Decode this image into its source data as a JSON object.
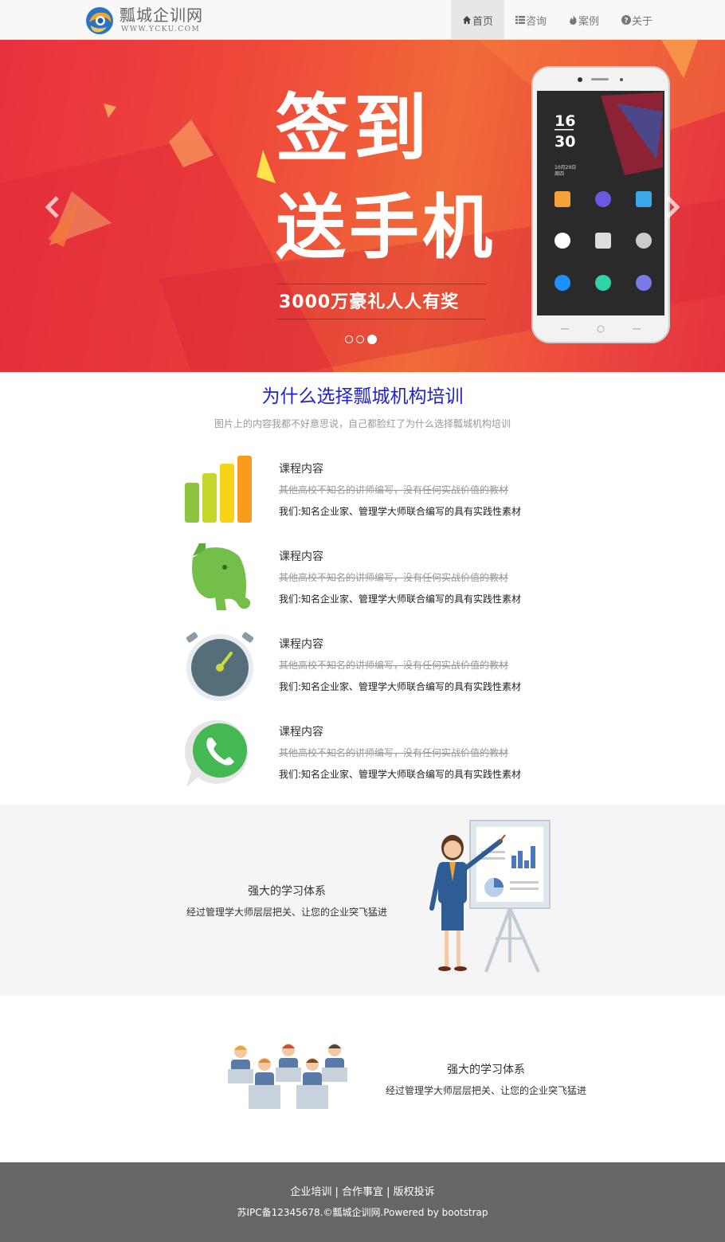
{
  "brand": {
    "name": "瓢城企训网",
    "url": "WWW.YCKU.COM"
  },
  "nav": {
    "items": [
      {
        "label": "首页",
        "icon": "home-icon"
      },
      {
        "label": "咨询",
        "icon": "list-icon"
      },
      {
        "label": "案例",
        "icon": "fire-icon"
      },
      {
        "label": "关于",
        "icon": "question-circle-icon"
      }
    ],
    "active_index": 0
  },
  "carousel": {
    "slide_title_line1": "签到",
    "slide_title_line2": "送手机",
    "slide_subtitle": "3000万豪礼人人有奖",
    "phone_screen": {
      "time_hour": "16",
      "time_minute": "30",
      "date": "10月29日",
      "weekday": "周四"
    },
    "indicator_count": 3,
    "active_indicator": 2
  },
  "why": {
    "title": "为什么选择瓢城机构培训",
    "subtitle": "图片上的内容我都不好意思说，自己都脸红了为什么选择瓢城机构培训",
    "features": [
      {
        "icon": "bar-chart-icon",
        "heading": "课程内容",
        "old_text": "其他高校不知名的讲师编写，没有任何实战价值的教材",
        "new_text": "我们:知名企业家、管理学大师联合编写的具有实践性素材"
      },
      {
        "icon": "elephant-icon",
        "heading": "课程内容",
        "old_text": "其他高校不知名的讲师编写，没有任何实战价值的教材",
        "new_text": "我们:知名企业家、管理学大师联合编写的具有实践性素材"
      },
      {
        "icon": "timer-icon",
        "heading": "课程内容",
        "old_text": "其他高校不知名的讲师编写，没有任何实战价值的教材",
        "new_text": "我们:知名企业家、管理学大师联合编写的具有实践性素材"
      },
      {
        "icon": "phone-chat-icon",
        "heading": "课程内容",
        "old_text": "其他高校不知名的讲师编写，没有任何实战价值的教材",
        "new_text": "我们:知名企业家、管理学大师联合编写的具有实践性素材"
      }
    ]
  },
  "learning_block_1": {
    "title": "强大的学习体系",
    "desc": "经过管理学大师层层把关、让您的企业突飞猛进"
  },
  "learning_block_2": {
    "title": "强大的学习体系",
    "desc": "经过管理学大师层层把关、让您的企业突飞猛进"
  },
  "footer": {
    "links": [
      "企业培训",
      "合作事宜",
      "版权投诉"
    ],
    "separator": " | ",
    "copyright": "苏IPC备12345678.©瓢城企训网.Powered by bootstrap"
  },
  "colors": {
    "title_blue": "#2121d9",
    "banner_red": "#e8303e",
    "banner_orange": "#f06a38",
    "footer_gray": "#666666"
  }
}
